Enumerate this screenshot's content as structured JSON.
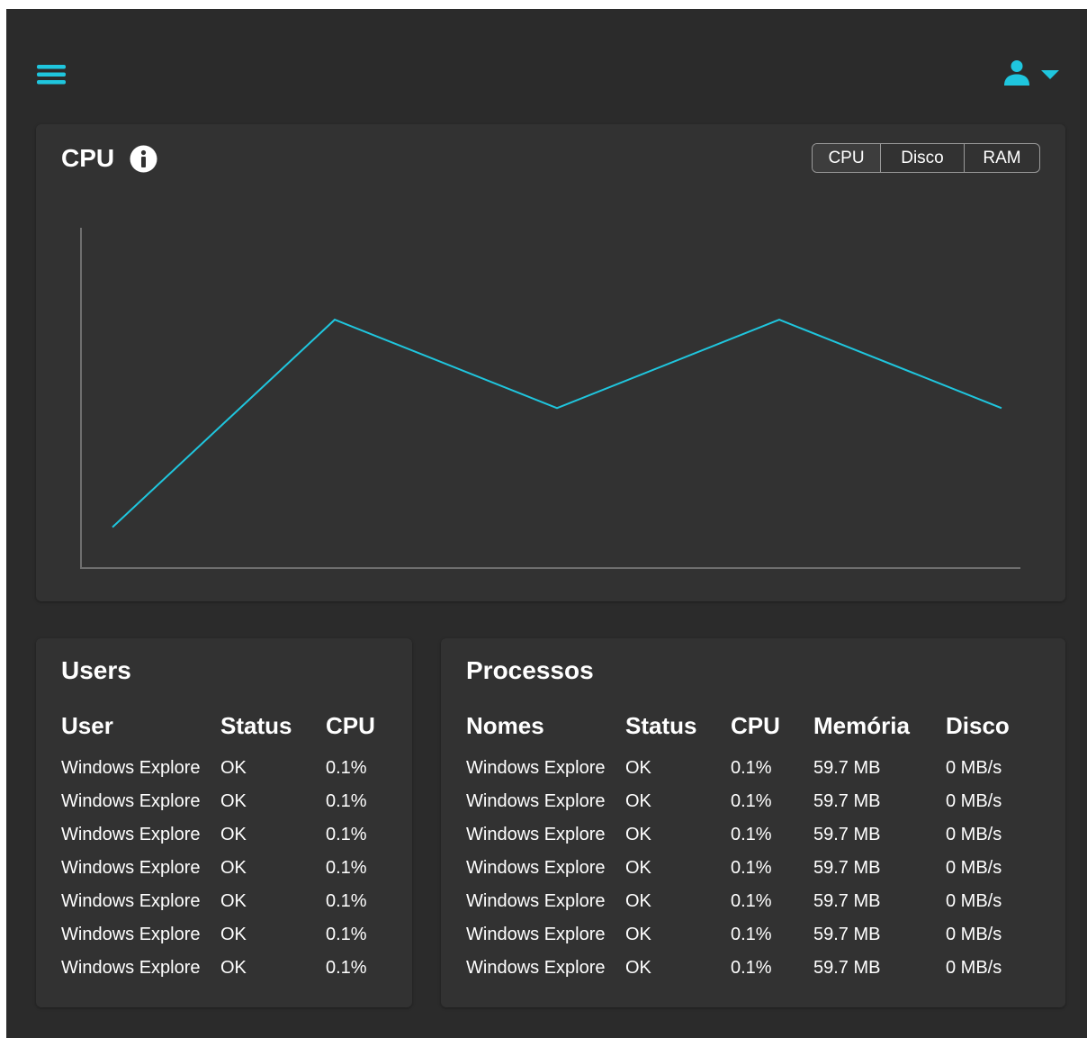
{
  "header": {
    "menu_icon": "hamburger-menu-icon",
    "user_icon": "user-icon",
    "dropdown_icon": "caret-down-icon"
  },
  "colors": {
    "accent": "#1fc6de",
    "background": "#2b2b2b",
    "card": "#323232",
    "axis": "#6f6f6f"
  },
  "cpu_card": {
    "title": "CPU",
    "info_icon": "info-icon",
    "tabs": [
      {
        "label": "CPU",
        "active": true
      },
      {
        "label": "Disco",
        "active": false
      },
      {
        "label": "RAM",
        "active": false
      }
    ]
  },
  "chart_data": {
    "type": "line",
    "title": "",
    "xlabel": "",
    "ylabel": "",
    "grid": false,
    "series": [
      {
        "values": [
          12,
          73,
          47,
          73,
          47
        ]
      }
    ],
    "ylim": [
      0,
      100
    ]
  },
  "users": {
    "title": "Users",
    "columns": [
      "User",
      "Status",
      "CPU"
    ],
    "rows": [
      [
        "Windows Explore",
        "OK",
        "0.1%"
      ],
      [
        "Windows Explore",
        "OK",
        "0.1%"
      ],
      [
        "Windows Explore",
        "OK",
        "0.1%"
      ],
      [
        "Windows Explore",
        "OK",
        "0.1%"
      ],
      [
        "Windows Explore",
        "OK",
        "0.1%"
      ],
      [
        "Windows Explore",
        "OK",
        "0.1%"
      ],
      [
        "Windows Explore",
        "OK",
        "0.1%"
      ]
    ]
  },
  "processes": {
    "title": "Processos",
    "columns": [
      "Nomes",
      "Status",
      "CPU",
      "Memória",
      "Disco"
    ],
    "rows": [
      [
        "Windows Explore",
        "OK",
        "0.1%",
        "59.7 MB",
        "0 MB/s"
      ],
      [
        "Windows Explore",
        "OK",
        "0.1%",
        "59.7 MB",
        "0 MB/s"
      ],
      [
        "Windows Explore",
        "OK",
        "0.1%",
        "59.7 MB",
        "0 MB/s"
      ],
      [
        "Windows Explore",
        "OK",
        "0.1%",
        "59.7 MB",
        "0 MB/s"
      ],
      [
        "Windows Explore",
        "OK",
        "0.1%",
        "59.7 MB",
        "0 MB/s"
      ],
      [
        "Windows Explore",
        "OK",
        "0.1%",
        "59.7 MB",
        "0 MB/s"
      ],
      [
        "Windows Explore",
        "OK",
        "0.1%",
        "59.7 MB",
        "0 MB/s"
      ]
    ]
  }
}
